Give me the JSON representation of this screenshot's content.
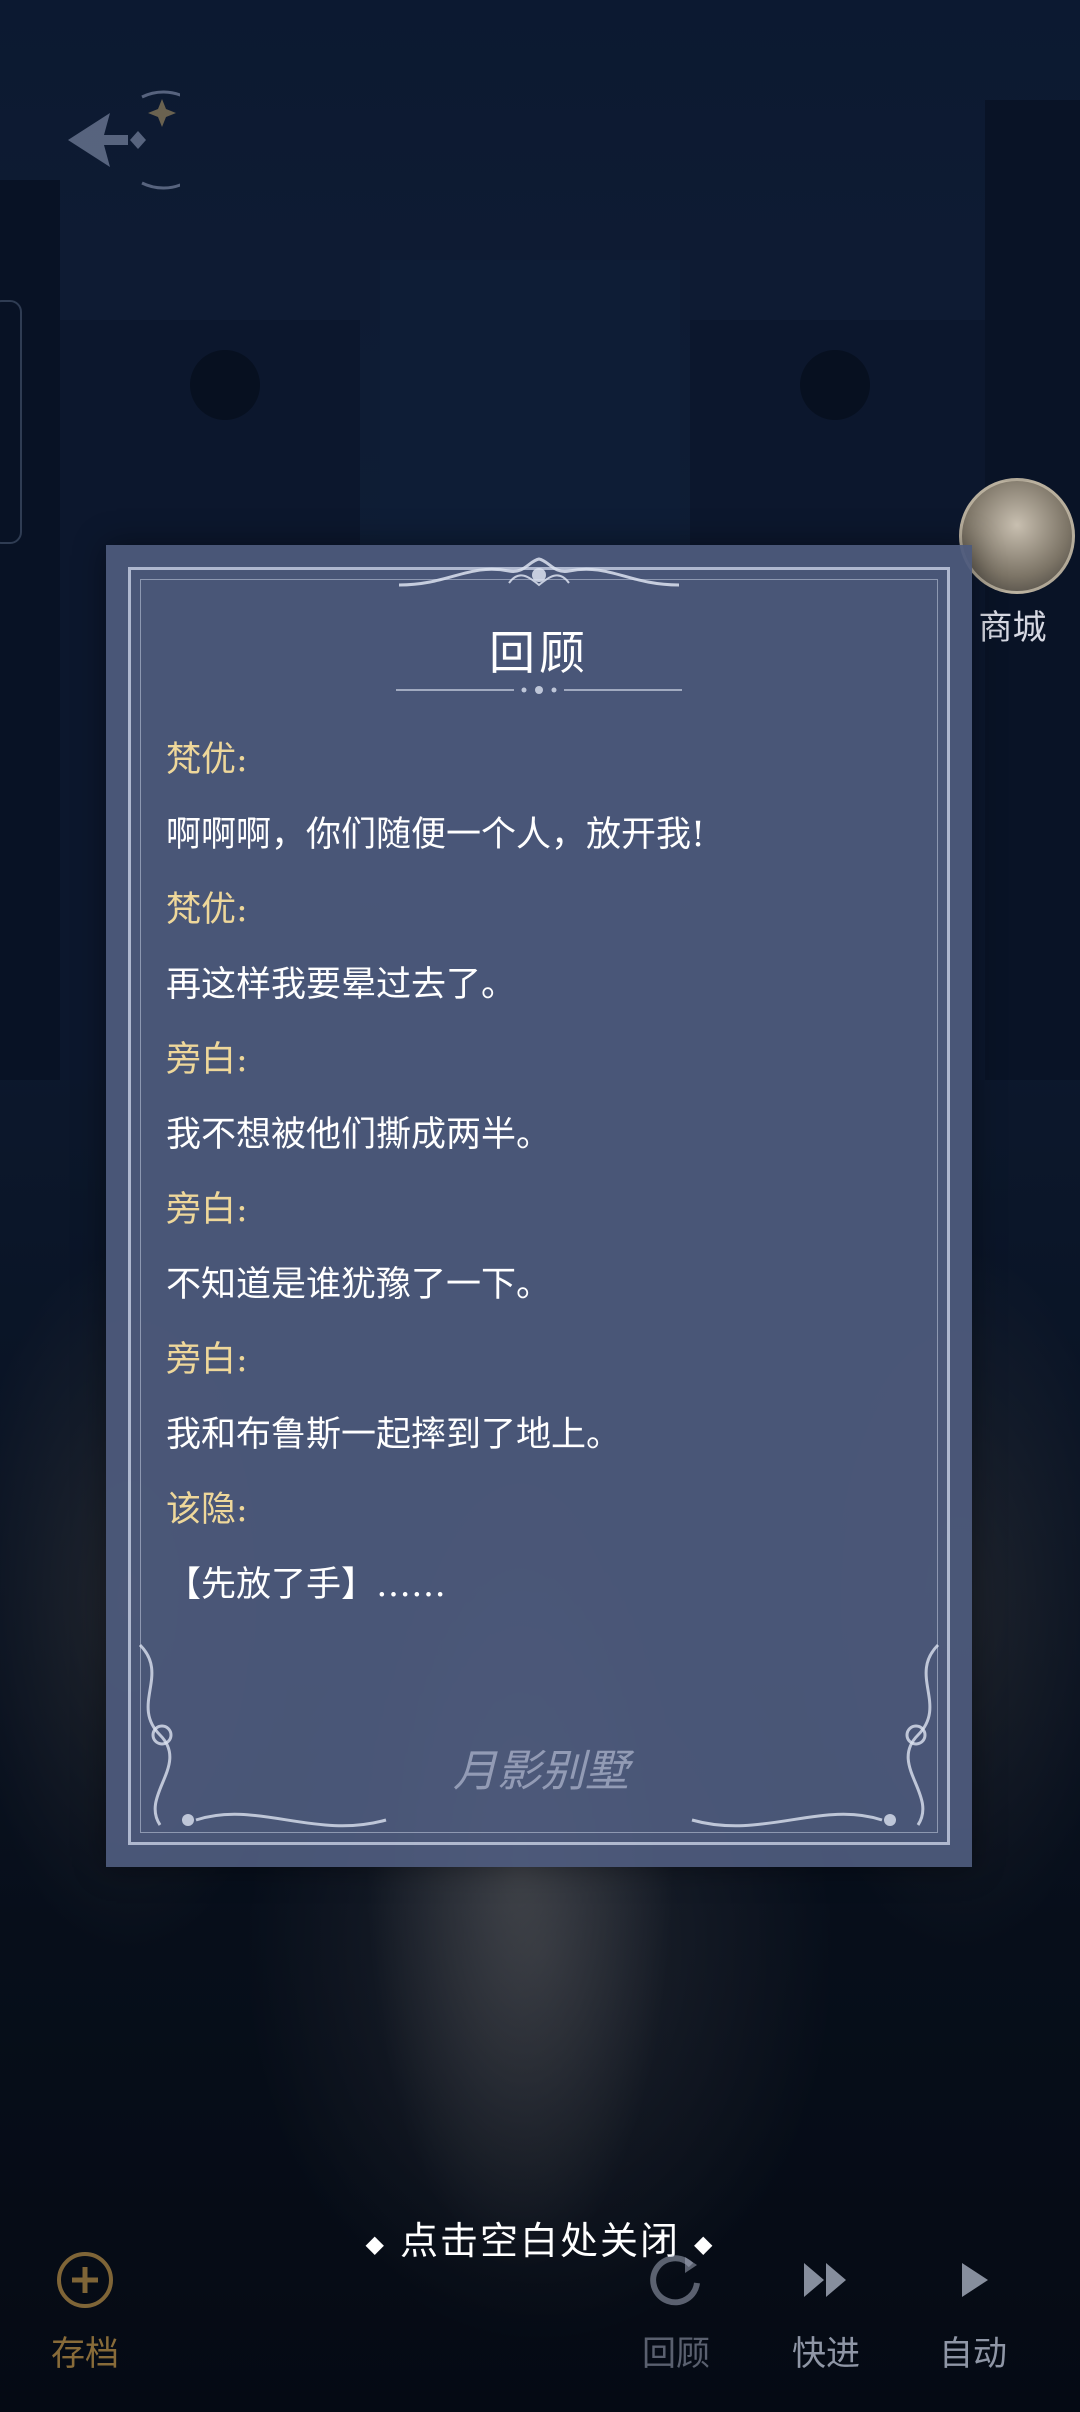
{
  "review": {
    "title": "回顾",
    "entries": [
      {
        "speaker": "梵优:",
        "line": "啊啊啊，你们随便一个人，放开我!"
      },
      {
        "speaker": "梵优:",
        "line": "再这样我要晕过去了。"
      },
      {
        "speaker": "旁白:",
        "line": "我不想被他们撕成两半。"
      },
      {
        "speaker": "旁白:",
        "line": "不知道是谁犹豫了一下。"
      },
      {
        "speaker": "旁白:",
        "line": "我和布鲁斯一起摔到了地上。"
      },
      {
        "speaker": "该隐:",
        "line": "【先放了手】……"
      }
    ],
    "logo": "月影别墅"
  },
  "shop": {
    "label": "商城"
  },
  "close_hint": {
    "text": "点击空白处关闭"
  },
  "toolbar": {
    "save": "存档",
    "review": "回顾",
    "skip": "快进",
    "auto": "自动"
  },
  "icons": {
    "back": "back-arrow-icon",
    "save": "save-icon",
    "review": "review-icon",
    "skip": "fast-forward-icon",
    "auto": "play-icon"
  },
  "colors": {
    "speaker": "#eed79a",
    "dialog_bg": "#4e5a7c",
    "text": "#ffffff"
  }
}
